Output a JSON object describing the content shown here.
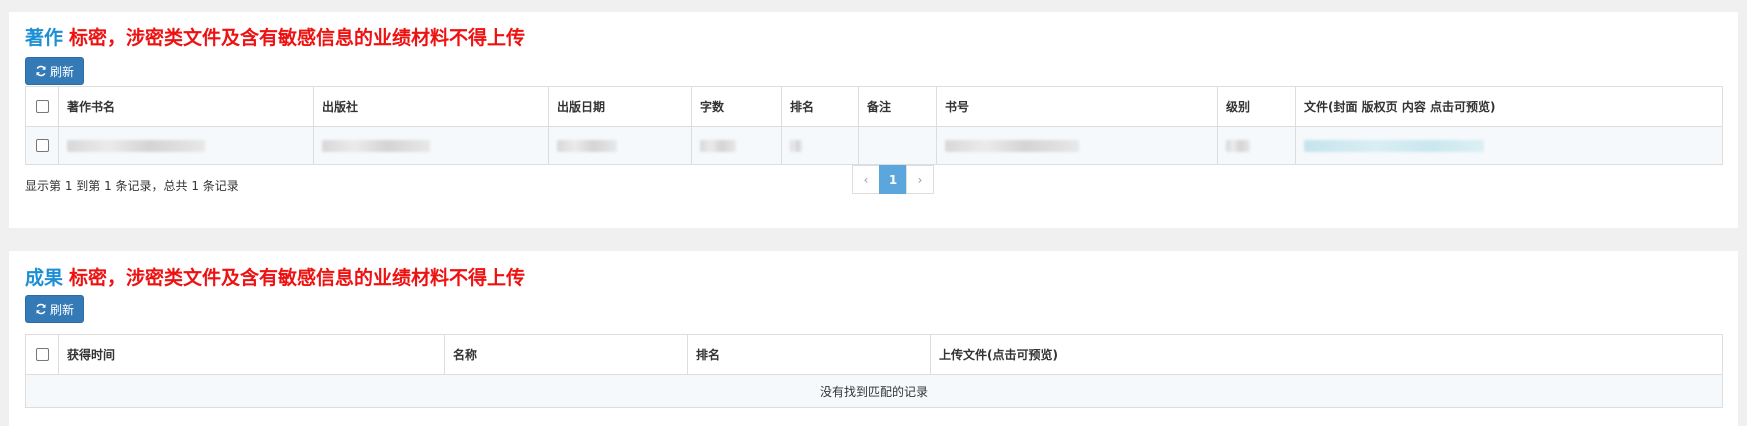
{
  "sections": [
    {
      "title": "著作",
      "warning": "标密，涉密类文件及含有敏感信息的业绩材料不得上传",
      "refresh_label": "刷新",
      "columns": [
        "著作书名",
        "出版社",
        "出版日期",
        "字数",
        "排名",
        "备注",
        "书号",
        "级别",
        "文件(封面 版权页 内容 点击可预览)"
      ],
      "pagination_text": "显示第 1 到第 1 条记录，总共 1 条记录",
      "pagination": {
        "prev": "‹",
        "current": "1",
        "next": "›"
      }
    },
    {
      "title": "成果",
      "warning": "标密，涉密类文件及含有敏感信息的业绩材料不得上传",
      "refresh_label": "刷新",
      "columns": [
        "获得时间",
        "名称",
        "排名",
        "上传文件(点击可预览)"
      ],
      "empty_text": "没有找到匹配的记录"
    }
  ],
  "colors": {
    "title_blue": "#1e8fd5",
    "warning_red": "#ee1111",
    "button_blue": "#337ab7",
    "active_page": "#5aa6dd"
  },
  "icons": {
    "refresh": "refresh-icon",
    "checkbox": "checkbox"
  }
}
